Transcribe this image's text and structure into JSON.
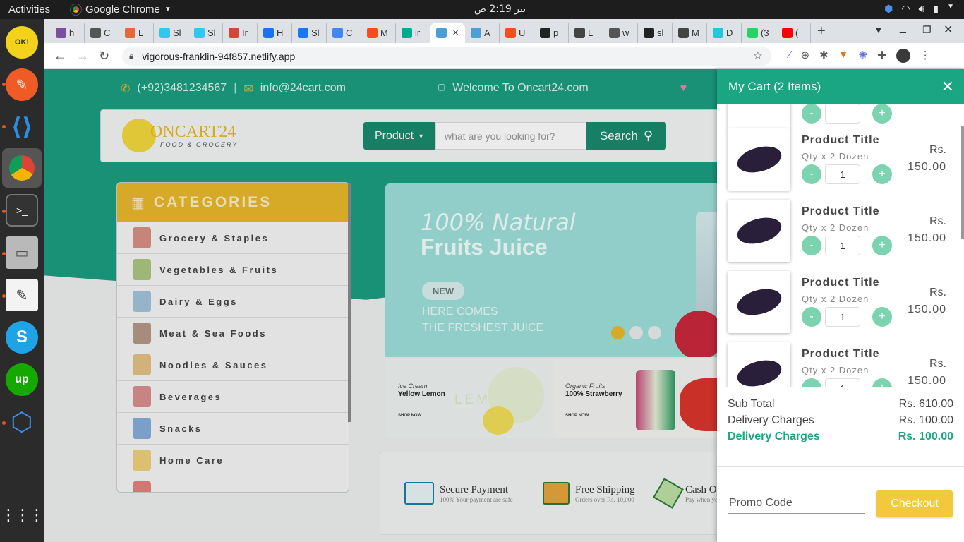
{
  "system": {
    "activities": "Activities",
    "app_name": "Google Chrome",
    "clock": "بير 2:19 ص"
  },
  "browser": {
    "tabs": [
      "h",
      "C",
      "L",
      "Sl",
      "Sl",
      "Ir",
      "H",
      "Sl",
      "C",
      "M",
      "ir",
      "",
      "A",
      "U",
      "p",
      "L",
      "w",
      "sl",
      "M",
      "D",
      "(3",
      "(",
      ""
    ],
    "url": "vigorous-franklin-94f857.netlify.app"
  },
  "site": {
    "phone": "(+92)3481234567",
    "email": "info@24cart.com",
    "welcome": "Welcome To Oncart24.com",
    "logo_name": "ONCART24",
    "logo_tag": "FOOD & GROCERY",
    "product_btn": "Product",
    "search_placeholder": "what are you looking for?",
    "search_btn": "Search",
    "categories_title": "CATEGORIES",
    "categories": [
      "Grocery & Staples",
      "Vegetables & Fruits",
      "Dairy & Eggs",
      "Meat & Sea Foods",
      "Noodles & Sauces",
      "Beverages",
      "Snacks",
      "Home Care"
    ],
    "hero": {
      "line1": "100% Natural",
      "line2": "Fruits Juice",
      "badge": "NEW",
      "line3": "HERE COMES",
      "line4": "THE FRESHEST JUICE"
    },
    "promo1": {
      "small": "Ice Cream",
      "big": "Yellow Lemon",
      "shop": "SHOP NOW",
      "deco": "LEM"
    },
    "promo2": {
      "small": "Organic Fruits",
      "big": "100% Strawberry",
      "shop": "SHOP NOW"
    },
    "features": [
      {
        "title": "Secure Payment",
        "sub": "100% Your payment are safe"
      },
      {
        "title": "Free Shipping",
        "sub": "Orders over Rs. 10,000"
      },
      {
        "title": "Cash On",
        "sub": "Pay when you"
      }
    ]
  },
  "cart": {
    "title": "My Cart (2 Items)",
    "items": [
      {
        "title": "Product Title",
        "qty": "Qty x 2 Dozen",
        "cur": "Rs.",
        "price": "150.00",
        "count": "1"
      },
      {
        "title": "Product Title",
        "qty": "Qty x 2 Dozen",
        "cur": "Rs.",
        "price": "150.00",
        "count": "1"
      },
      {
        "title": "Product Title",
        "qty": "Qty x 2 Dozen",
        "cur": "Rs.",
        "price": "150.00",
        "count": "1"
      },
      {
        "title": "Product Title",
        "qty": "Qty x 2 Dozen",
        "cur": "Rs.",
        "price": "150.00",
        "count": "1"
      }
    ],
    "subtotal_label": "Sub Total",
    "subtotal": "Rs. 610.00",
    "delivery_label": "Delivery Charges",
    "delivery": "Rs. 100.00",
    "delivery2_label": "Delivery Charges",
    "delivery2": "Rs. 100.00",
    "promo_placeholder": "Promo Code",
    "checkout": "Checkout"
  },
  "colors": {
    "brand_green": "#1aa682",
    "accent_yellow": "#f2c93d"
  }
}
